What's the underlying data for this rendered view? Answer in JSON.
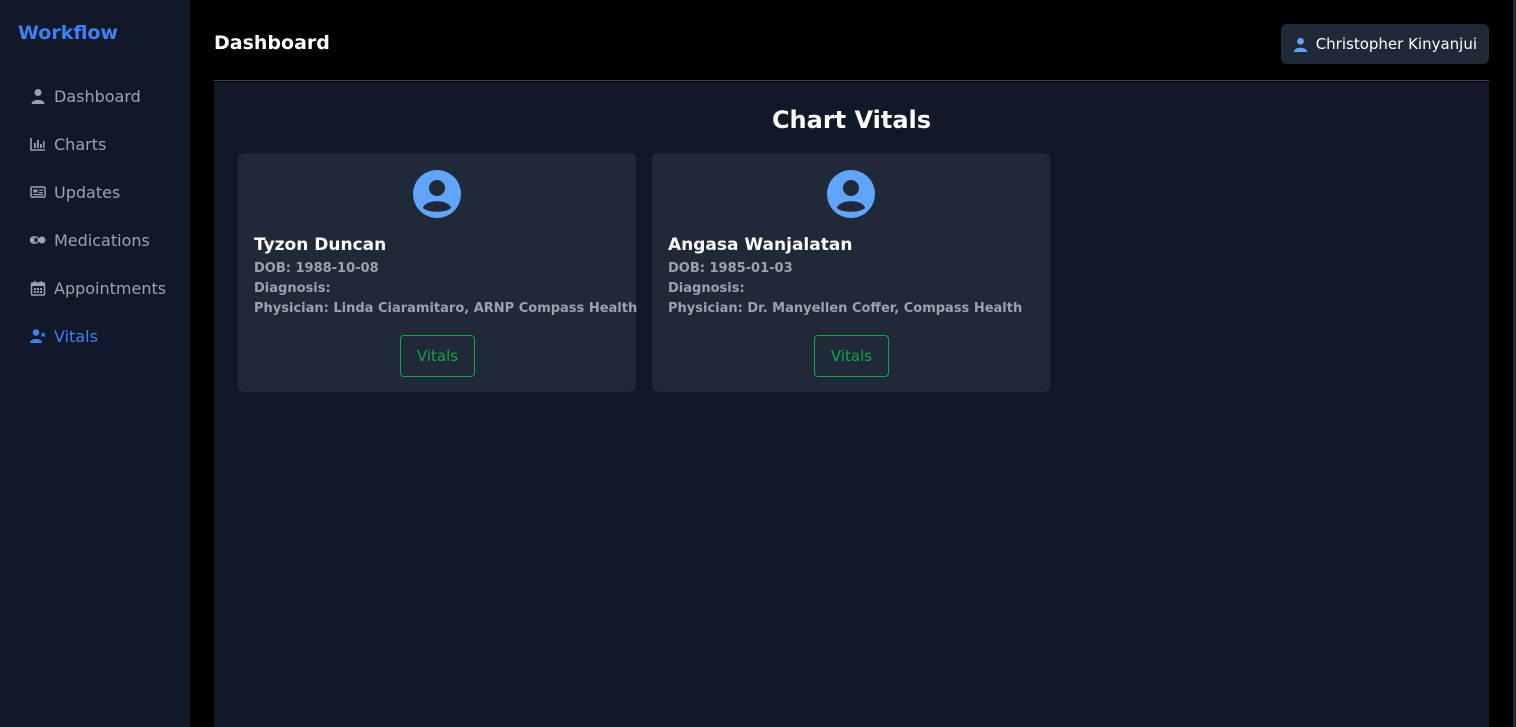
{
  "sidebar": {
    "brand": "Workflow",
    "items": [
      {
        "label": "Dashboard",
        "icon": "user-icon",
        "active": false
      },
      {
        "label": "Charts",
        "icon": "chart-bar-icon",
        "active": false
      },
      {
        "label": "Updates",
        "icon": "newspaper-icon",
        "active": false
      },
      {
        "label": "Medications",
        "icon": "pills-icon",
        "active": false
      },
      {
        "label": "Appointments",
        "icon": "calendar-icon",
        "active": false
      },
      {
        "label": "Vitals",
        "icon": "user-xmark-icon",
        "active": true
      }
    ]
  },
  "header": {
    "title": "Dashboard",
    "user_name": "Christopher Kinyanjui"
  },
  "main": {
    "title": "Chart Vitals",
    "patients": [
      {
        "name": "Tyzon Duncan",
        "dob": "DOB: 1988-10-08",
        "diagnosis": "Diagnosis:",
        "physician": "Physician: Linda Ciaramitaro, ARNP Compass Health",
        "button": "Vitals"
      },
      {
        "name": "Angasa Wanjalatan",
        "dob": "DOB: 1985-01-03",
        "diagnosis": "Diagnosis:",
        "physician": "Physician: Dr. Manyellen Coffer, Compass Health",
        "button": "Vitals"
      }
    ]
  },
  "colors": {
    "accent": "#3b82f6",
    "button_green": "#16a34a",
    "sidebar_bg": "#111827",
    "card_bg": "#1f2937"
  }
}
